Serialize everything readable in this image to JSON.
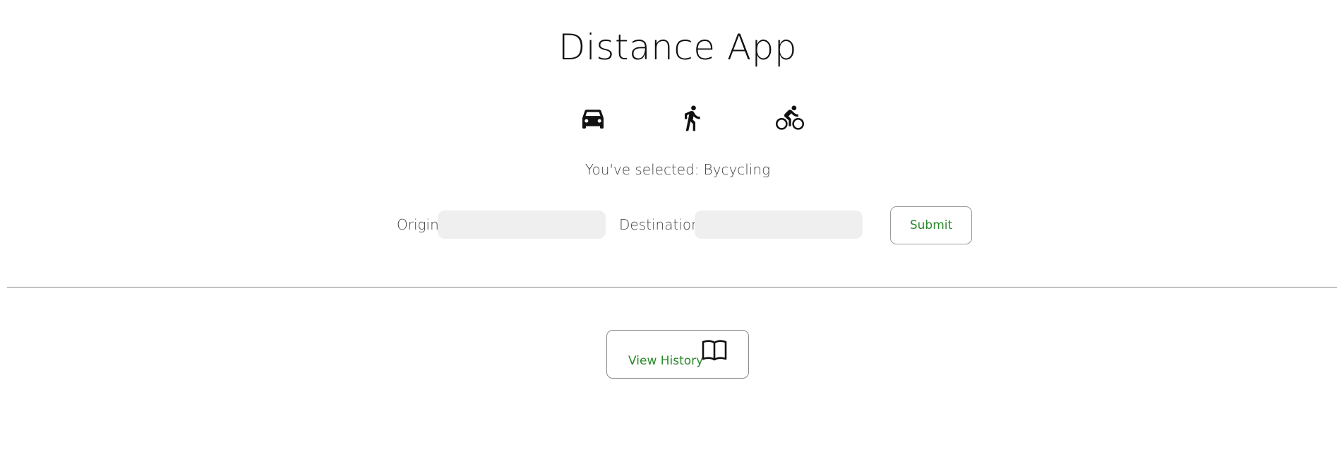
{
  "header": {
    "title": "Distance App"
  },
  "modes": {
    "items": [
      {
        "name": "car",
        "icon": "car-icon"
      },
      {
        "name": "walking",
        "icon": "walking-icon"
      },
      {
        "name": "bycycling",
        "icon": "bicycle-icon"
      }
    ]
  },
  "selection": {
    "prefix": "You've selected:",
    "value": "Bycycling"
  },
  "form": {
    "origin_label": "Origin",
    "origin_value": "",
    "origin_placeholder": "",
    "destination_label": "Destination",
    "destination_value": "",
    "destination_placeholder": "",
    "submit_label": "Submit"
  },
  "history": {
    "button_label": "View History",
    "icon": "book-icon"
  },
  "colors": {
    "accent": "#2a8a2a",
    "input_bg": "#efefef"
  }
}
